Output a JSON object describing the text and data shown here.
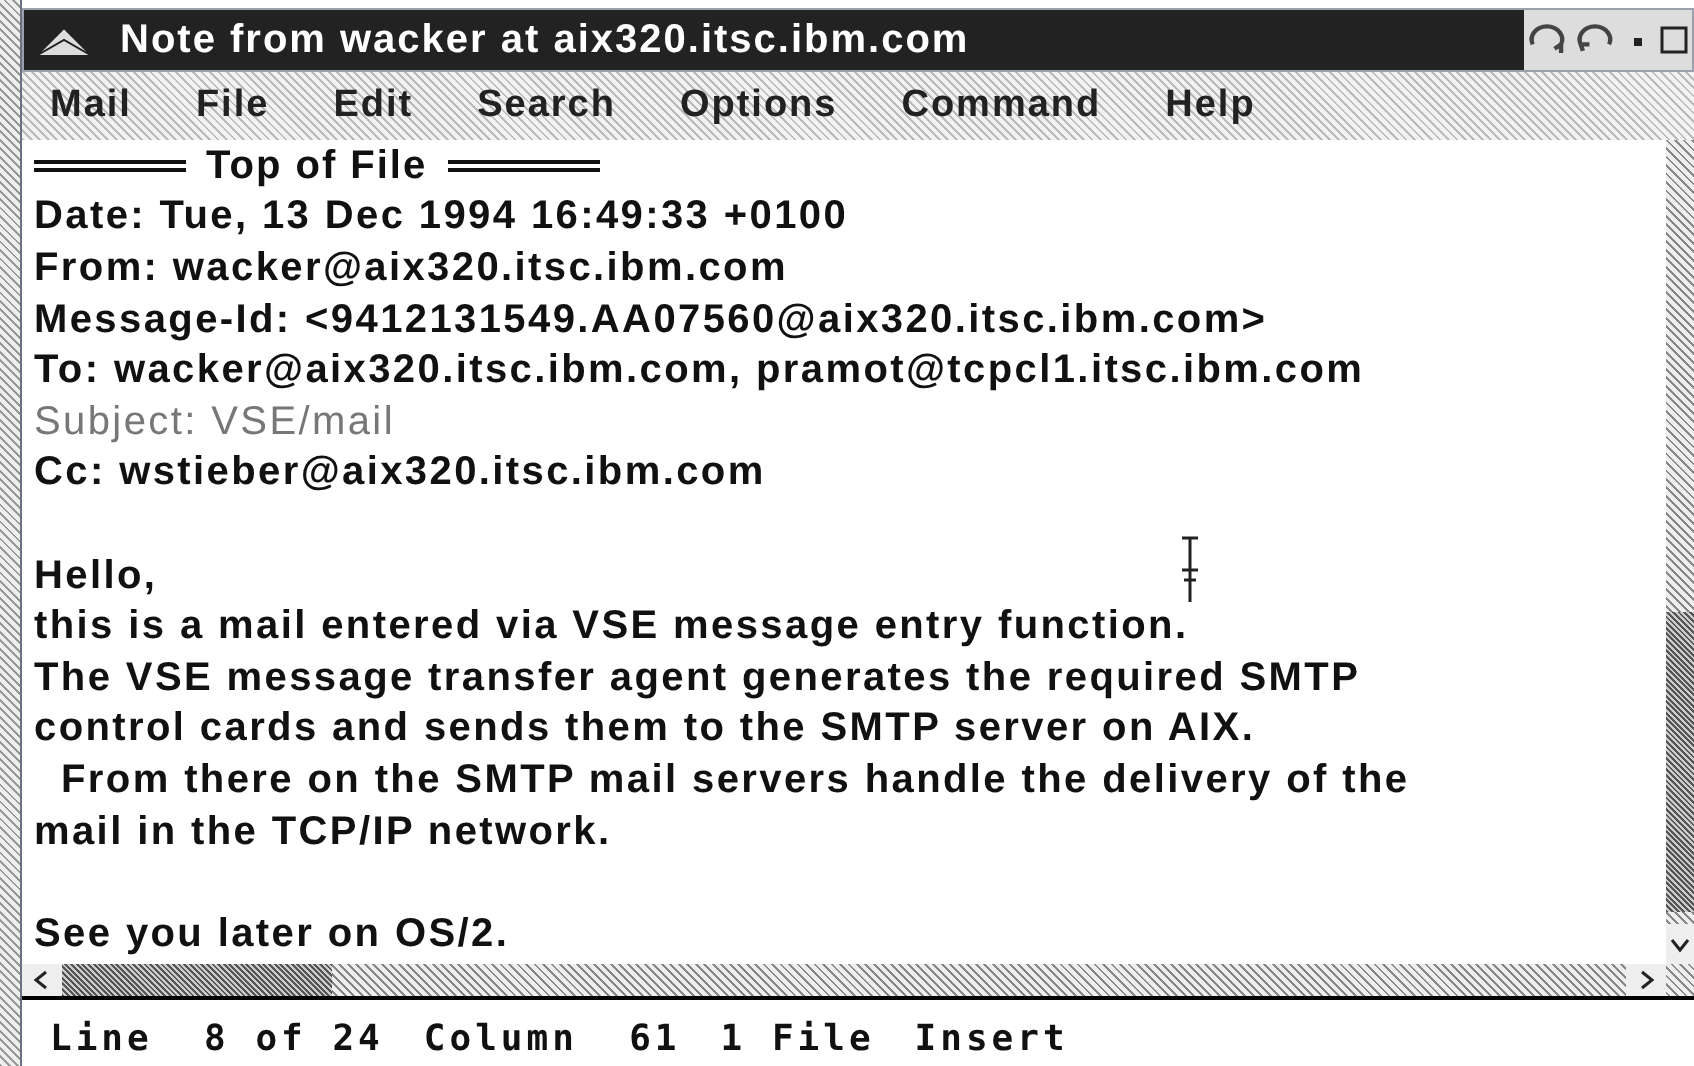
{
  "window": {
    "title": "Note from wacker at aix320.itsc.ibm.com"
  },
  "menu": [
    {
      "label": "Mail"
    },
    {
      "label": "File"
    },
    {
      "label": "Edit"
    },
    {
      "label": "Search"
    },
    {
      "label": "Options"
    },
    {
      "label": "Command"
    },
    {
      "label": "Help"
    }
  ],
  "editor": {
    "top_marker": "Top of File",
    "lines": [
      {
        "kind": "text",
        "text": "Date: Tue, 13 Dec 1994 16:49:33 +0100",
        "dimmed": false
      },
      {
        "kind": "text",
        "text": "From: wacker@aix320.itsc.ibm.com",
        "dimmed": false
      },
      {
        "kind": "text",
        "text": "Message-Id: <9412131549.AA07560@aix320.itsc.ibm.com>",
        "dimmed": false
      },
      {
        "kind": "text",
        "text": "To: wacker@aix320.itsc.ibm.com, pramot@tcpcl1.itsc.ibm.com",
        "dimmed": false
      },
      {
        "kind": "text",
        "text": "Subject: VSE/mail",
        "dimmed": true
      },
      {
        "kind": "text",
        "text": "Cc: wstieber@aix320.itsc.ibm.com",
        "dimmed": false
      },
      {
        "kind": "blank"
      },
      {
        "kind": "text",
        "text": "Hello,",
        "dimmed": false
      },
      {
        "kind": "text",
        "text": "this is a mail entered via VSE message entry function.",
        "dimmed": false
      },
      {
        "kind": "text",
        "text": "The VSE message transfer agent generates the required SMTP",
        "dimmed": false
      },
      {
        "kind": "text",
        "text": "control cards and sends them to the SMTP server on AIX.",
        "dimmed": false
      },
      {
        "kind": "text",
        "text": "  From there on the SMTP mail servers handle the delivery of the",
        "dimmed": false
      },
      {
        "kind": "text",
        "text": "mail in the TCP/IP network.",
        "dimmed": false
      },
      {
        "kind": "blank"
      },
      {
        "kind": "text",
        "text": "See you later on OS/2.",
        "dimmed": false
      }
    ]
  },
  "status_bar": [
    "Line  8 of 24",
    "Column  61",
    "1 File",
    "Insert"
  ]
}
